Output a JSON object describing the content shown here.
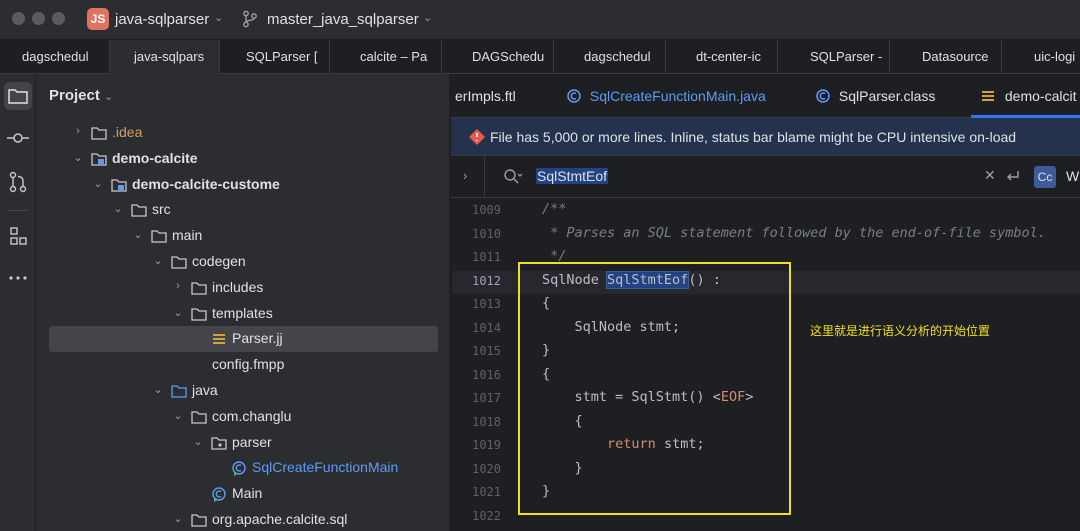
{
  "titlebar": {
    "project_badge": "JS",
    "project_name": "java-sqlparser",
    "branch": "master_java_sqlparser"
  },
  "file_tabs": [
    "dagschedul",
    "java-sqlpars",
    "SQLParser [",
    "calcite – Pa",
    "DAGSchedu",
    "dagschedul",
    "dt-center-ic",
    "SQLParser -",
    "Datasource",
    "uic-logi"
  ],
  "project_panel": {
    "header": "Project",
    "tree": [
      {
        "label": ".idea",
        "arrow": "›",
        "icon": "folder-icon",
        "indent": 0,
        "style": "muted"
      },
      {
        "label": "demo-calcite",
        "arrow": "⌄",
        "icon": "module-icon",
        "indent": 0,
        "style": "bold"
      },
      {
        "label": "demo-calcite-custome",
        "arrow": "⌄",
        "icon": "module-icon",
        "indent": 1,
        "style": "bold"
      },
      {
        "label": "src",
        "arrow": "⌄",
        "icon": "folder-icon",
        "indent": 2,
        "style": ""
      },
      {
        "label": "main",
        "arrow": "⌄",
        "icon": "folder-icon",
        "indent": 3,
        "style": ""
      },
      {
        "label": "codegen",
        "arrow": "⌄",
        "icon": "folder-icon",
        "indent": 4,
        "style": ""
      },
      {
        "label": "includes",
        "arrow": "›",
        "icon": "folder-icon",
        "indent": 5,
        "style": ""
      },
      {
        "label": "templates",
        "arrow": "⌄",
        "icon": "folder-icon",
        "indent": 5,
        "style": ""
      },
      {
        "label": "Parser.jj",
        "arrow": "",
        "icon": "file-lines-icon",
        "indent": 6,
        "style": "",
        "selected": true
      },
      {
        "label": "config.fmpp",
        "arrow": "",
        "icon": "file-icon",
        "indent": 5,
        "style": ""
      },
      {
        "label": "java",
        "arrow": "⌄",
        "icon": "source-folder-icon",
        "indent": 4,
        "style": ""
      },
      {
        "label": "com.changlu",
        "arrow": "⌄",
        "icon": "folder-icon",
        "indent": 5,
        "style": ""
      },
      {
        "label": "parser",
        "arrow": "⌄",
        "icon": "package-icon",
        "indent": 6,
        "style": ""
      },
      {
        "label": "SqlCreateFunctionMain",
        "arrow": "",
        "icon": "class-run-icon",
        "indent": 7,
        "style": "blue"
      },
      {
        "label": "Main",
        "arrow": "",
        "icon": "class-run-icon",
        "indent": 6,
        "style": ""
      },
      {
        "label": "org.apache.calcite.sql",
        "arrow": "⌄",
        "icon": "folder-icon",
        "indent": 5,
        "style": ""
      }
    ]
  },
  "editor": {
    "tabs": [
      {
        "label": "erImpls.ftl",
        "icon": ""
      },
      {
        "label": "SqlCreateFunctionMain.java",
        "icon": "class-run-icon"
      },
      {
        "label": "SqlParser.class",
        "icon": "class-icon"
      },
      {
        "label": "demo-calcit",
        "icon": "file-lines-icon"
      }
    ],
    "banner": "File has 5,000 or more lines. Inline, status bar blame might be CPU intensive on-load",
    "search": {
      "value": "SqlStmtEof",
      "match_case": "Cc",
      "words": "W"
    },
    "lines": [
      {
        "num": "1009",
        "text": "/**"
      },
      {
        "num": "1010",
        "text": " * Parses an SQL statement followed by the end-of-file symbol."
      },
      {
        "num": "1011",
        "text": " */"
      },
      {
        "num": "1012",
        "text": "SqlNode SqlStmtEof() :"
      },
      {
        "num": "1013",
        "text": "{"
      },
      {
        "num": "1014",
        "text": "    SqlNode stmt;"
      },
      {
        "num": "1015",
        "text": "}"
      },
      {
        "num": "1016",
        "text": "{"
      },
      {
        "num": "1017",
        "text": "    stmt = SqlStmt() <EOF>"
      },
      {
        "num": "1018",
        "text": "    {"
      },
      {
        "num": "1019",
        "text": "        return stmt;"
      },
      {
        "num": "1020",
        "text": "    }"
      },
      {
        "num": "1021",
        "text": "}"
      },
      {
        "num": "1022",
        "text": ""
      }
    ],
    "annotation": "这里就是进行语义分析的开始位置"
  },
  "colors": {
    "accent": "#3574f0",
    "annotation": "#f0e020",
    "banner_bg": "#25324d",
    "warning": "#e55b4b"
  }
}
